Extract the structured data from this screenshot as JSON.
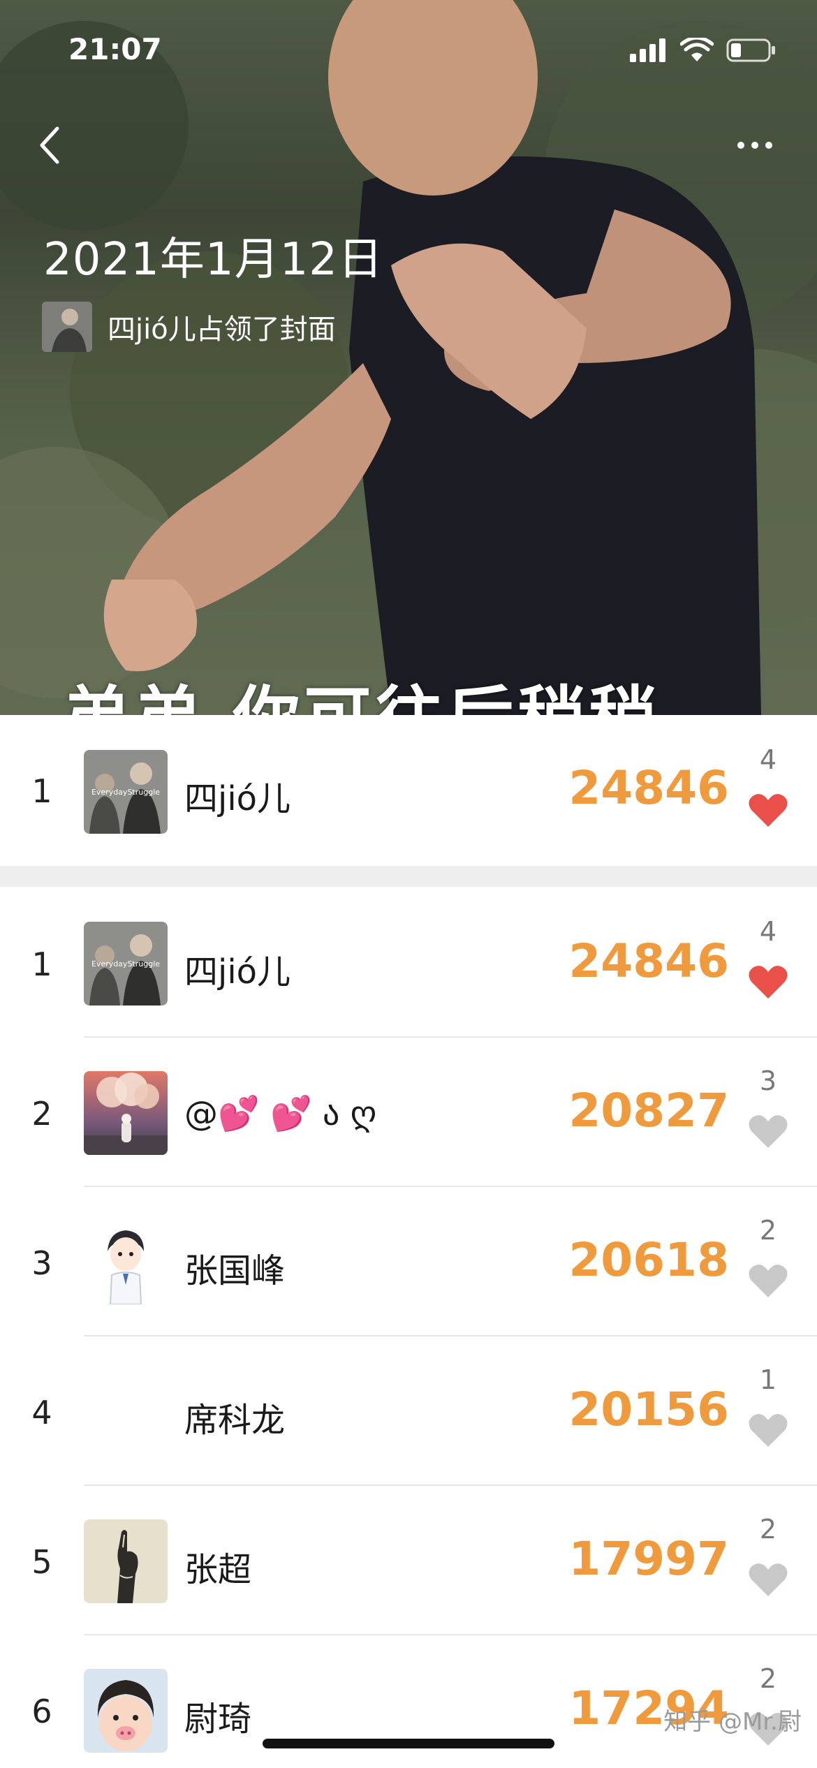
{
  "status_bar": {
    "time": "21:07"
  },
  "cover": {
    "title": "2021年1月12日",
    "owner_label": "四jió儿占领了封面",
    "caption": "弟弟 你可往后稍稍"
  },
  "top_entry": {
    "rank": "1",
    "name": "四jió儿",
    "steps": "24846",
    "likes": "4",
    "liked": true
  },
  "leaderboard": [
    {
      "rank": "1",
      "name": "四jió儿",
      "steps": "24846",
      "likes": "4",
      "liked": true
    },
    {
      "rank": "2",
      "name": "@💕 💕  ა ღ",
      "steps": "20827",
      "likes": "3",
      "liked": false
    },
    {
      "rank": "3",
      "name": "张国峰",
      "steps": "20618",
      "likes": "2",
      "liked": false
    },
    {
      "rank": "4",
      "name": "席科龙",
      "steps": "20156",
      "likes": "1",
      "liked": false
    },
    {
      "rank": "5",
      "name": "张超",
      "steps": "17997",
      "likes": "2",
      "liked": false
    },
    {
      "rank": "6",
      "name": "尉琦",
      "steps": "17294",
      "likes": "2",
      "liked": false
    }
  ],
  "watermark": "知乎 @Mr.尉",
  "colors": {
    "steps": "#ef9a3c",
    "heart_liked": "#e9504a",
    "heart_unliked": "#c8c8c8"
  }
}
